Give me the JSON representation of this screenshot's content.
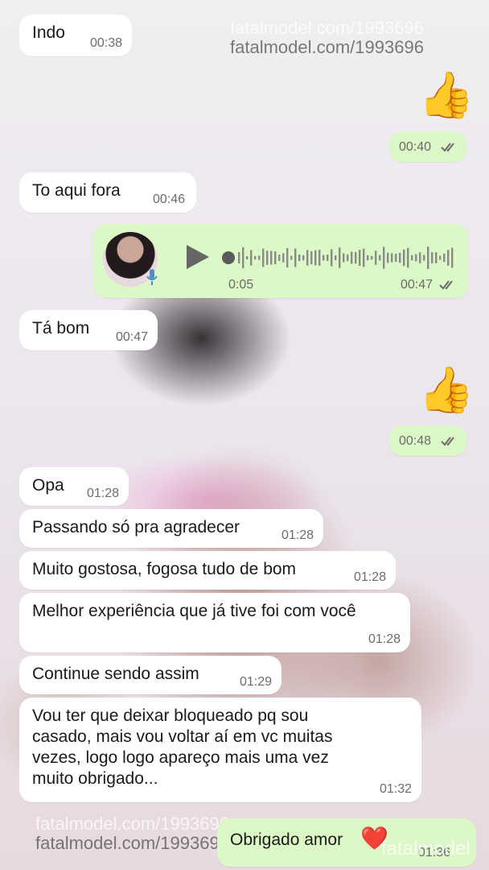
{
  "watermark": {
    "top": "fatalmodel.com/1993696",
    "bottom": "fatalmodel.com/1993696",
    "brand": "fatalmodel"
  },
  "messages": [
    {
      "text": "Indo",
      "time": "00:38"
    },
    {
      "emoji": "👍",
      "time": "00:40"
    },
    {
      "text": "To aqui fora",
      "time": "00:46"
    },
    {
      "voice_duration": "0:05",
      "time": "00:47"
    },
    {
      "text": "Tá bom",
      "time": "00:47"
    },
    {
      "emoji": "👍",
      "time": "00:48"
    },
    {
      "text": "Opa",
      "time": "01:28"
    },
    {
      "text": "Passando só pra agradecer",
      "time": "01:28"
    },
    {
      "text": "Muito gostosa, fogosa tudo de bom",
      "time": "01:28"
    },
    {
      "text": "Melhor experiência que já tive foi com você",
      "time": "01:28"
    },
    {
      "text": "Continue sendo assim",
      "time": "01:29"
    },
    {
      "text": "Vou ter que deixar bloqueado pq sou\ncasado, mais vou voltar aí em vc muitas\nvezes, logo logo apareço mais uma vez\nmuito obrigado...",
      "time": "01:32"
    },
    {
      "text": "Obrigado amor",
      "emoji": "❤️",
      "time": "01:36"
    }
  ],
  "icons": {
    "read_ticks": "double-check-icon",
    "play": "play-icon",
    "mic": "mic-icon"
  },
  "colors": {
    "incoming": "#ffffff",
    "outgoing": "#dcf8c6"
  }
}
